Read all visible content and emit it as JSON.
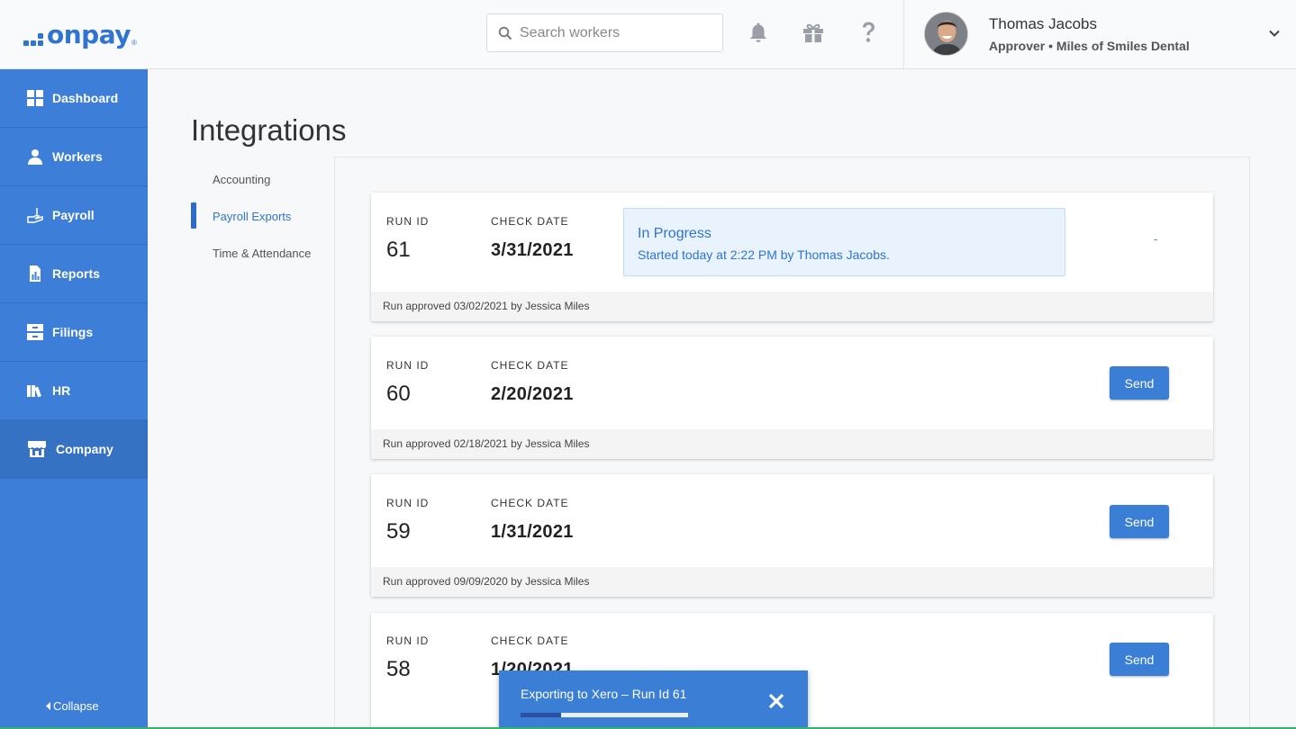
{
  "header": {
    "logo_text": "onpay",
    "logo_mark": "®",
    "search_placeholder": "Search workers",
    "icons": [
      "search-icon",
      "bell-icon",
      "gift-icon",
      "question-icon",
      "chevron-down-icon"
    ],
    "user_name": "Thomas Jacobs",
    "user_role": "Approver • Miles of Smiles Dental"
  },
  "sidebar": {
    "items": [
      {
        "label": "Dashboard",
        "icon": "dashboard-icon"
      },
      {
        "label": "Workers",
        "icon": "workers-icon"
      },
      {
        "label": "Payroll",
        "icon": "payroll-icon"
      },
      {
        "label": "Reports",
        "icon": "reports-icon"
      },
      {
        "label": "Filings",
        "icon": "filings-icon"
      },
      {
        "label": "HR",
        "icon": "hr-icon"
      },
      {
        "label": "Company",
        "icon": "company-icon",
        "active": true
      }
    ],
    "collapse_label": "Collapse"
  },
  "main": {
    "title": "Integrations",
    "subnav": [
      {
        "label": "Accounting"
      },
      {
        "label": "Payroll Exports",
        "active": true
      },
      {
        "label": "Time & Attendance"
      }
    ],
    "col_run_id": "RUN ID",
    "col_check_date": "CHECK DATE",
    "runs": [
      {
        "run_id": "61",
        "check_date": "3/31/2021",
        "footer": "Run approved 03/02/2021 by Jessica Miles",
        "status_title": "In Progress",
        "status_sub": "Started today at 2:22 PM by Thomas Jacobs.",
        "action": "-"
      },
      {
        "run_id": "60",
        "check_date": "2/20/2021",
        "footer": "Run approved 02/18/2021 by Jessica Miles",
        "action": "Send"
      },
      {
        "run_id": "59",
        "check_date": "1/31/2021",
        "footer": "Run approved 09/09/2020 by Jessica Miles",
        "action": "Send"
      },
      {
        "run_id": "58",
        "check_date": "1/20/2021",
        "action": "Send"
      }
    ]
  },
  "toast": {
    "text": "Exporting to Xero – Run Id 61",
    "progress": 0.24
  },
  "colors": {
    "brand": "#2f74d0",
    "sidebar": "#3d7fd8",
    "button": "#3a7fd5",
    "progress_bg": "#e8f3fd"
  }
}
